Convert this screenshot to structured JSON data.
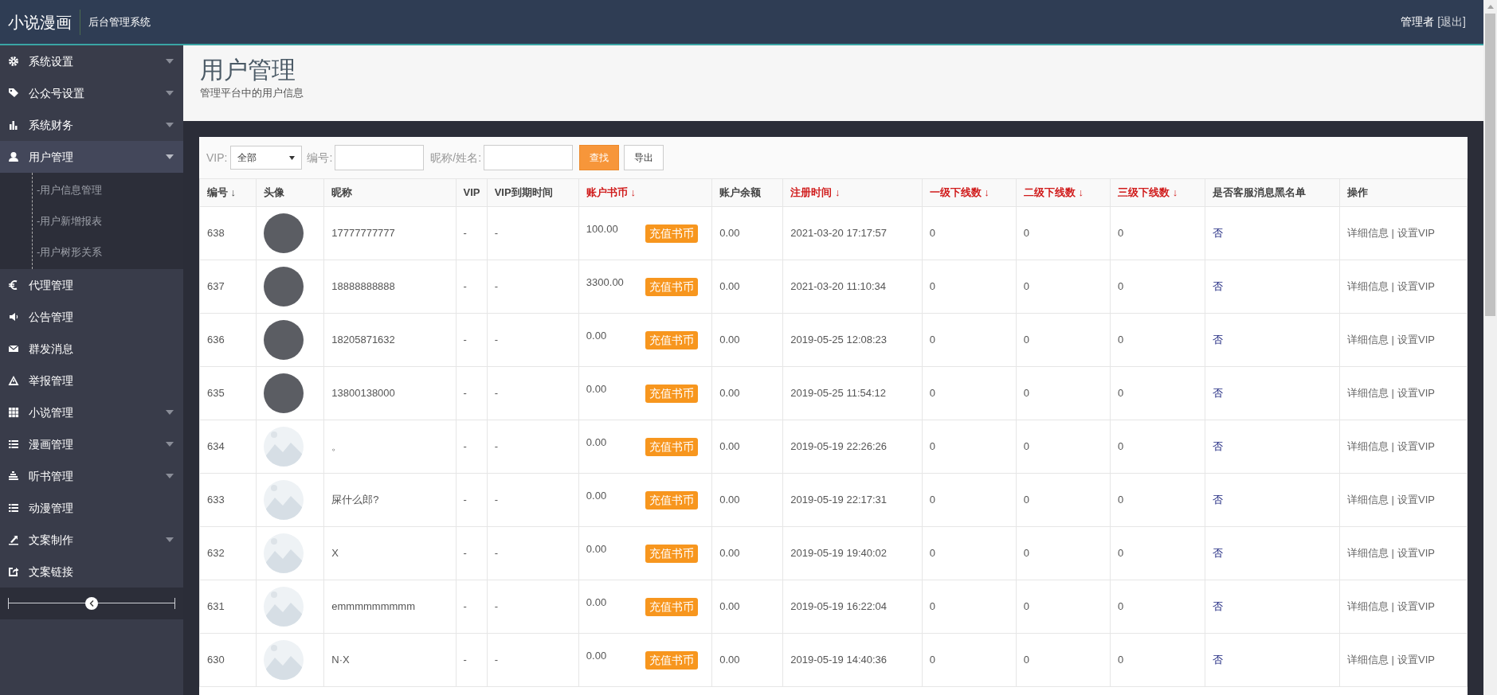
{
  "header": {
    "brand": "小说漫画",
    "subtitle": "后台管理系统",
    "user": "管理者",
    "logout": "[退出]"
  },
  "sidebar": {
    "items": [
      {
        "label": "系统设置",
        "kind": "group",
        "expanded": false
      },
      {
        "label": "公众号设置",
        "kind": "group",
        "expanded": false
      },
      {
        "label": "系统财务",
        "kind": "group",
        "expanded": false
      },
      {
        "label": "用户管理",
        "kind": "group",
        "expanded": true,
        "children": [
          {
            "label": "-用户信息管理"
          },
          {
            "label": "-用户新增报表"
          },
          {
            "label": "-用户树形关系"
          }
        ]
      },
      {
        "label": "代理管理",
        "kind": "link"
      },
      {
        "label": "公告管理",
        "kind": "link"
      },
      {
        "label": "群发消息",
        "kind": "link"
      },
      {
        "label": "举报管理",
        "kind": "link"
      },
      {
        "label": "小说管理",
        "kind": "group",
        "expanded": false
      },
      {
        "label": "漫画管理",
        "kind": "group",
        "expanded": false
      },
      {
        "label": "听书管理",
        "kind": "group",
        "expanded": false
      },
      {
        "label": "动漫管理",
        "kind": "link"
      },
      {
        "label": "文案制作",
        "kind": "group",
        "expanded": false
      },
      {
        "label": "文案链接",
        "kind": "link"
      }
    ],
    "collapse_slider": {
      "level": 0.5
    }
  },
  "page": {
    "title": "用户管理",
    "description": "管理平台中的用户信息"
  },
  "filters": {
    "vip_label": "VIP:",
    "vip_value": "全部",
    "id_label": "编号:",
    "name_label": "昵称/姓名:",
    "search_button": "查找",
    "export_button": "导出"
  },
  "table": {
    "columns": [
      {
        "label": "编号",
        "arrow": "↓",
        "highlight": false
      },
      {
        "label": "头像",
        "highlight": false
      },
      {
        "label": "昵称",
        "highlight": false
      },
      {
        "label": "VIP",
        "highlight": false
      },
      {
        "label": "VIP到期时间",
        "highlight": false
      },
      {
        "label": "账户书币",
        "arrow": "↓",
        "highlight": true
      },
      {
        "label": "账户余额",
        "highlight": false
      },
      {
        "label": "注册时间",
        "arrow": "↓",
        "highlight": true
      },
      {
        "label": "一级下线数",
        "arrow": "↓",
        "highlight": true
      },
      {
        "label": "二级下线数",
        "arrow": "↓",
        "highlight": true
      },
      {
        "label": "三级下线数",
        "arrow": "↓",
        "highlight": true
      },
      {
        "label": "是否客服消息黑名单",
        "highlight": false
      },
      {
        "label": "操作",
        "highlight": false
      }
    ],
    "rows": [
      {
        "id": "638",
        "kind": "photo",
        "nickname": "17777777777",
        "vip": "-",
        "vip_expiry": "-",
        "coins": "100.00",
        "recharge": "充值书币",
        "balance": "0.00",
        "registered": "2021-03-20 17:17:57",
        "level1": "0",
        "level2": "0",
        "level3": "0",
        "blacklist": "否",
        "details": "详细信息",
        "separator": "|",
        "set_vip": "设置VIP"
      },
      {
        "id": "637",
        "kind": "photo",
        "nickname": "18888888888",
        "vip": "-",
        "vip_expiry": "-",
        "coins": "3300.00",
        "recharge": "充值书币",
        "balance": "0.00",
        "registered": "2021-03-20 11:10:34",
        "level1": "0",
        "level2": "0",
        "level3": "0",
        "blacklist": "否",
        "details": "详细信息",
        "separator": "|",
        "set_vip": "设置VIP"
      },
      {
        "id": "636",
        "kind": "photo",
        "nickname": "18205871632",
        "vip": "-",
        "vip_expiry": "-",
        "coins": "0.00",
        "recharge": "充值书币",
        "balance": "0.00",
        "registered": "2019-05-25 12:08:23",
        "level1": "0",
        "level2": "0",
        "level3": "0",
        "blacklist": "否",
        "details": "详细信息",
        "separator": "|",
        "set_vip": "设置VIP"
      },
      {
        "id": "635",
        "kind": "photo",
        "nickname": "13800138000",
        "vip": "-",
        "vip_expiry": "-",
        "coins": "0.00",
        "recharge": "充值书币",
        "balance": "0.00",
        "registered": "2019-05-25 11:54:12",
        "level1": "0",
        "level2": "0",
        "level3": "0",
        "blacklist": "否",
        "details": "详细信息",
        "separator": "|",
        "set_vip": "设置VIP"
      },
      {
        "id": "634",
        "kind": "placeholder",
        "nickname": "。",
        "vip": "-",
        "vip_expiry": "-",
        "coins": "0.00",
        "recharge": "充值书币",
        "balance": "0.00",
        "registered": "2019-05-19 22:26:26",
        "level1": "0",
        "level2": "0",
        "level3": "0",
        "blacklist": "否",
        "details": "详细信息",
        "separator": "|",
        "set_vip": "设置VIP"
      },
      {
        "id": "633",
        "kind": "placeholder",
        "nickname": "屎什么郎?",
        "vip": "-",
        "vip_expiry": "-",
        "coins": "0.00",
        "recharge": "充值书币",
        "balance": "0.00",
        "registered": "2019-05-19 22:17:31",
        "level1": "0",
        "level2": "0",
        "level3": "0",
        "blacklist": "否",
        "details": "详细信息",
        "separator": "|",
        "set_vip": "设置VIP"
      },
      {
        "id": "632",
        "kind": "placeholder",
        "nickname": "X",
        "vip": "-",
        "vip_expiry": "-",
        "coins": "0.00",
        "recharge": "充值书币",
        "balance": "0.00",
        "registered": "2019-05-19 19:40:02",
        "level1": "0",
        "level2": "0",
        "level3": "0",
        "blacklist": "否",
        "details": "详细信息",
        "separator": "|",
        "set_vip": "设置VIP"
      },
      {
        "id": "631",
        "kind": "placeholder",
        "nickname": "emmmmmmmmm",
        "vip": "-",
        "vip_expiry": "-",
        "coins": "0.00",
        "recharge": "充值书币",
        "balance": "0.00",
        "registered": "2019-05-19 16:22:04",
        "level1": "0",
        "level2": "0",
        "level3": "0",
        "blacklist": "否",
        "details": "详细信息",
        "separator": "|",
        "set_vip": "设置VIP"
      },
      {
        "id": "630",
        "kind": "placeholder",
        "nickname": "N·X",
        "vip": "-",
        "vip_expiry": "-",
        "coins": "0.00",
        "recharge": "充值书币",
        "balance": "0.00",
        "registered": "2019-05-19 14:40:36",
        "level1": "0",
        "level2": "0",
        "level3": "0",
        "blacklist": "否",
        "details": "详细信息",
        "separator": "|",
        "set_vip": "设置VIP"
      }
    ]
  }
}
